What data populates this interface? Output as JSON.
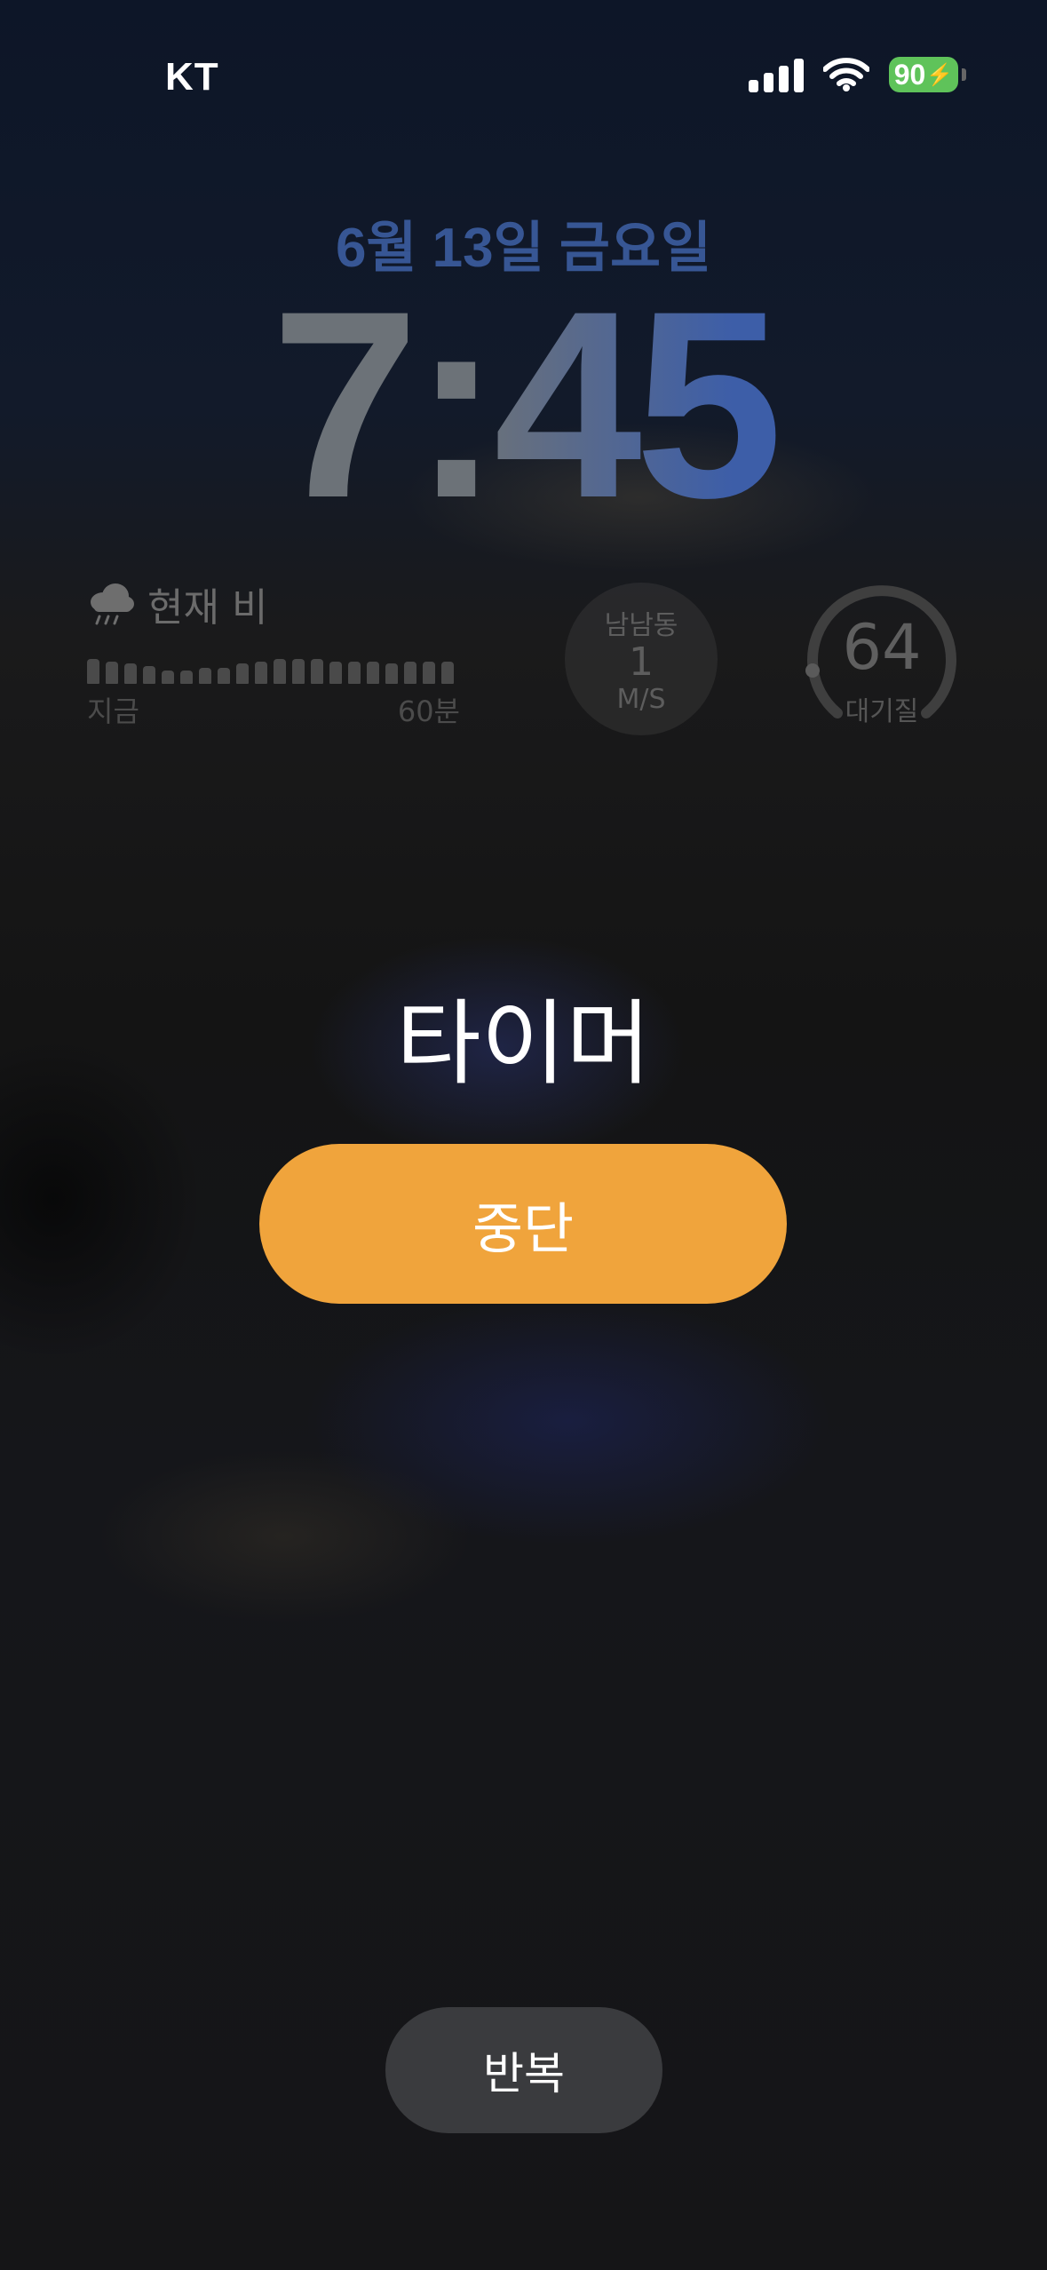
{
  "status_bar": {
    "carrier": "KT",
    "battery_level": "90",
    "signal_icon": "cellular-signal-icon",
    "wifi_icon": "wifi-icon",
    "battery_color": "#5fc35a"
  },
  "lock_screen": {
    "date": "6월 13일 금요일",
    "time": "7:45"
  },
  "widgets": {
    "rain": {
      "icon": "rain-cloud-icon",
      "title": "현재 비",
      "start_label": "지금",
      "end_label": "60분",
      "intensity": [
        0.55,
        0.5,
        0.45,
        0.4,
        0.3,
        0.3,
        0.35,
        0.35,
        0.45,
        0.5,
        0.55,
        0.55,
        0.55,
        0.5,
        0.5,
        0.5,
        0.45,
        0.5,
        0.5,
        0.5
      ]
    },
    "wind": {
      "direction": "남남동",
      "speed": "1",
      "unit": "M/S"
    },
    "air_quality": {
      "value": "64",
      "label": "대기질"
    }
  },
  "timer_alert": {
    "title": "타이머",
    "stop_label": "중단",
    "stop_color": "#f0a43c",
    "repeat_label": "반복"
  }
}
